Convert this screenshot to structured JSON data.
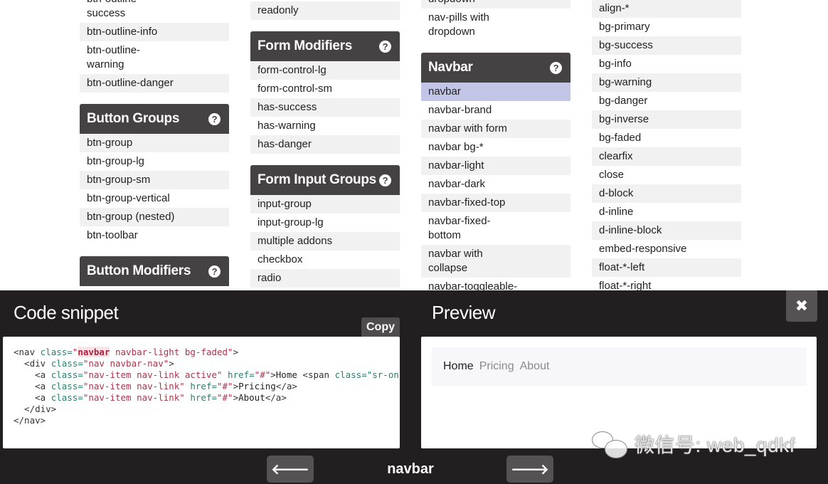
{
  "columns": [
    {
      "groups": [
        {
          "title": null,
          "items": [
            {
              "label": "btn-outline-success",
              "odd": false
            },
            {
              "label": "btn-outline-info",
              "odd": true
            },
            {
              "label": "btn-outline-warning",
              "odd": false
            },
            {
              "label": "btn-outline-danger",
              "odd": true
            }
          ]
        },
        {
          "title": "Button Groups",
          "items": [
            {
              "label": "btn-group",
              "odd": true
            },
            {
              "label": "btn-group-lg",
              "odd": false
            },
            {
              "label": "btn-group-sm",
              "odd": true
            },
            {
              "label": "btn-group-vertical",
              "odd": false
            },
            {
              "label": "btn-group (nested)",
              "odd": true
            },
            {
              "label": "btn-toolbar",
              "odd": false
            }
          ]
        },
        {
          "title": "Button Modifiers",
          "items": []
        }
      ]
    },
    {
      "groups": [
        {
          "title": null,
          "items": [
            {
              "label": "readonly",
              "odd": true
            }
          ]
        },
        {
          "title": "Form Modifiers",
          "items": [
            {
              "label": "form-control-lg",
              "odd": true
            },
            {
              "label": "form-control-sm",
              "odd": false
            },
            {
              "label": "has-success",
              "odd": true
            },
            {
              "label": "has-warning",
              "odd": false
            },
            {
              "label": "has-danger",
              "odd": true
            }
          ]
        },
        {
          "title": "Form Input Groups",
          "items": [
            {
              "label": "input-group",
              "odd": true
            },
            {
              "label": "input-group-lg",
              "odd": false
            },
            {
              "label": "multiple addons",
              "odd": true
            },
            {
              "label": "checkbox",
              "odd": false
            },
            {
              "label": "radio",
              "odd": true
            }
          ]
        }
      ]
    },
    {
      "groups": [
        {
          "title": null,
          "items": [
            {
              "label": "dropdown",
              "odd": true
            },
            {
              "label": "nav-pills with dropdown",
              "odd": false
            }
          ]
        },
        {
          "title": "Navbar",
          "items": [
            {
              "label": "navbar",
              "odd": true,
              "active": true
            },
            {
              "label": "navbar-brand",
              "odd": false
            },
            {
              "label": "navbar with form",
              "odd": true
            },
            {
              "label": "navbar bg-*",
              "odd": false
            },
            {
              "label": "navbar-light",
              "odd": true
            },
            {
              "label": "navbar-dark",
              "odd": false
            },
            {
              "label": "navbar-fixed-top",
              "odd": true
            },
            {
              "label": "navbar-fixed-bottom",
              "odd": false
            },
            {
              "label": "navbar with collapse",
              "odd": true
            },
            {
              "label": "navbar-toggleable-",
              "odd": false
            }
          ]
        }
      ]
    },
    {
      "groups": [
        {
          "title": null,
          "items": [
            {
              "label": "align-*",
              "odd": true
            },
            {
              "label": "bg-primary",
              "odd": false
            },
            {
              "label": "bg-success",
              "odd": true
            },
            {
              "label": "bg-info",
              "odd": false
            },
            {
              "label": "bg-warning",
              "odd": true
            },
            {
              "label": "bg-danger",
              "odd": false
            },
            {
              "label": "bg-inverse",
              "odd": true
            },
            {
              "label": "bg-faded",
              "odd": false
            },
            {
              "label": "clearfix",
              "odd": true
            },
            {
              "label": "close",
              "odd": false
            },
            {
              "label": "d-block",
              "odd": true
            },
            {
              "label": "d-inline",
              "odd": false
            },
            {
              "label": "d-inline-block",
              "odd": true
            },
            {
              "label": "embed-responsive",
              "odd": false
            },
            {
              "label": "float-*-left",
              "odd": true
            },
            {
              "label": "float-*-right",
              "odd": false
            }
          ]
        }
      ]
    }
  ],
  "help_icon": "question-circle-icon",
  "overlay": {
    "code_title": "Code snippet",
    "copy_label": "Copy",
    "preview_title": "Preview",
    "close_icon": "close-icon",
    "code_lines": [
      [
        {
          "t": "tag",
          "v": "<nav "
        },
        {
          "t": "attr",
          "v": "class="
        },
        {
          "t": "str",
          "v": "\""
        },
        {
          "t": "hl",
          "v": "navbar"
        },
        {
          "t": "str",
          "v": " navbar-light bg-faded\""
        },
        {
          "t": "tag",
          "v": ">"
        }
      ],
      [
        {
          "t": "tag",
          "v": "  <div "
        },
        {
          "t": "attr",
          "v": "class="
        },
        {
          "t": "str",
          "v": "\"nav navbar-nav\""
        },
        {
          "t": "tag",
          "v": ">"
        }
      ],
      [
        {
          "t": "tag",
          "v": "    <a "
        },
        {
          "t": "attr",
          "v": "class="
        },
        {
          "t": "str",
          "v": "\"nav-item nav-link active\""
        },
        {
          "t": "attr",
          "v": " href="
        },
        {
          "t": "str",
          "v": "\"#\""
        },
        {
          "t": "tag",
          "v": ">"
        },
        {
          "t": "text",
          "v": "Home "
        },
        {
          "t": "tag",
          "v": "<span "
        },
        {
          "t": "attr",
          "v": "class=\"sr-only\">(current)</span></a>"
        }
      ],
      [
        {
          "t": "tag",
          "v": "    <a "
        },
        {
          "t": "attr",
          "v": "class="
        },
        {
          "t": "str",
          "v": "\"nav-item nav-link\""
        },
        {
          "t": "attr",
          "v": " href="
        },
        {
          "t": "str",
          "v": "\"#\""
        },
        {
          "t": "tag",
          "v": ">"
        },
        {
          "t": "text",
          "v": "Pricing"
        },
        {
          "t": "tag",
          "v": "</a>"
        }
      ],
      [
        {
          "t": "tag",
          "v": "    <a "
        },
        {
          "t": "attr",
          "v": "class="
        },
        {
          "t": "str",
          "v": "\"nav-item nav-link\""
        },
        {
          "t": "attr",
          "v": " href="
        },
        {
          "t": "str",
          "v": "\"#\""
        },
        {
          "t": "tag",
          "v": ">"
        },
        {
          "t": "text",
          "v": "About"
        },
        {
          "t": "tag",
          "v": "</a>"
        }
      ],
      [
        {
          "t": "tag",
          "v": "  </div>"
        }
      ],
      [
        {
          "t": "tag",
          "v": "</nav>"
        }
      ]
    ],
    "preview_nav": [
      {
        "label": "Home",
        "active": true
      },
      {
        "label": "Pricing",
        "active": false
      },
      {
        "label": "About",
        "active": false
      }
    ],
    "prev_icon": "arrow-left-icon",
    "next_icon": "arrow-right-icon",
    "current_label": "navbar"
  },
  "watermark": {
    "text": "微信号: web_qdkf",
    "icon": "wechat-icon"
  }
}
